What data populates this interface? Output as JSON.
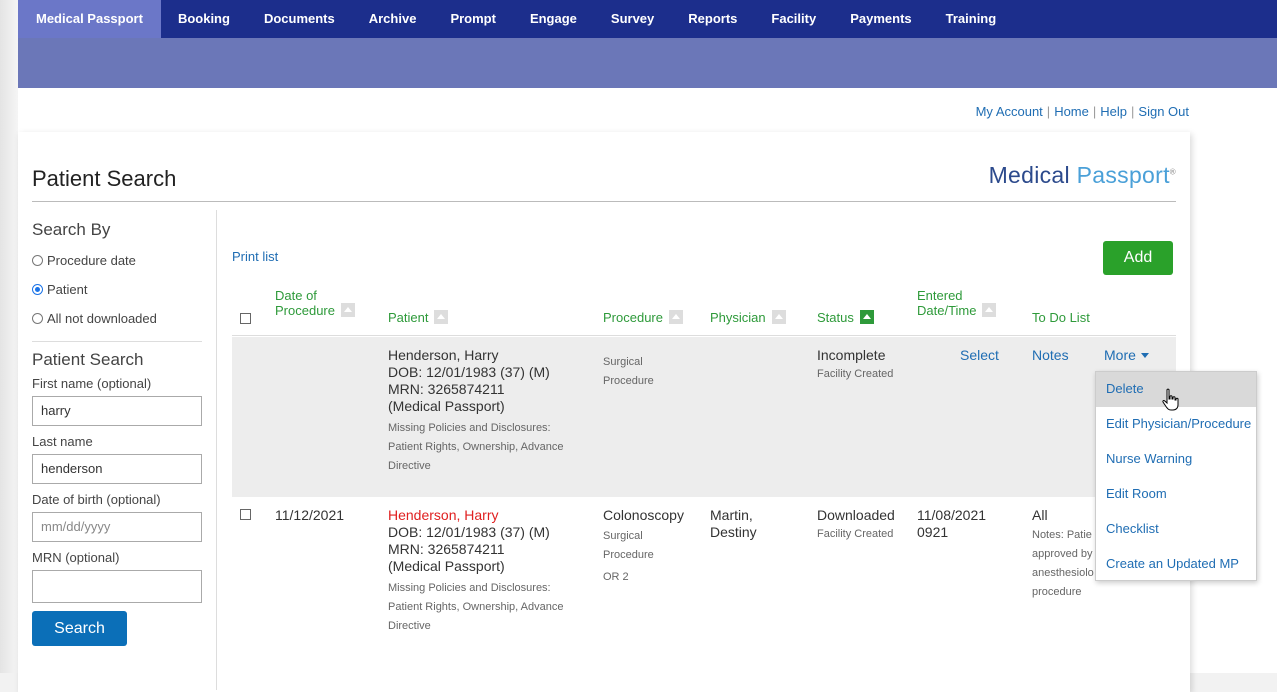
{
  "nav": {
    "tabs": [
      {
        "label": "Medical Passport"
      },
      {
        "label": "Booking"
      },
      {
        "label": "Documents"
      },
      {
        "label": "Archive"
      },
      {
        "label": "Prompt"
      },
      {
        "label": "Engage"
      },
      {
        "label": "Survey"
      },
      {
        "label": "Reports"
      },
      {
        "label": "Facility"
      },
      {
        "label": "Payments"
      },
      {
        "label": "Training"
      }
    ],
    "active_index": 0,
    "colors": {
      "bar": "#1c2e8c",
      "active": "#6b77c8",
      "subbar": "#6b77b8"
    }
  },
  "utility": {
    "my_account": "My Account",
    "home": "Home",
    "help": "Help",
    "sign_out": "Sign Out",
    "separator": "|"
  },
  "page": {
    "title": "Patient Search",
    "brand_bold": "Medical",
    "brand_light": " Passport",
    "brand_mark": "®"
  },
  "sidebar": {
    "search_by_heading": "Search By",
    "options": [
      {
        "label": "Procedure date",
        "checked": false
      },
      {
        "label": "Patient",
        "checked": true
      },
      {
        "label": "All not downloaded",
        "checked": false
      }
    ],
    "patient_search_heading": "Patient Search",
    "first_name_label": "First name (optional)",
    "first_name_value": "harry",
    "last_name_label": "Last name",
    "last_name_value": "henderson",
    "dob_label": "Date of birth (optional)",
    "dob_placeholder": "mm/dd/yyyy",
    "mrn_label": "MRN (optional)",
    "mrn_value": "",
    "search_button": "Search"
  },
  "main": {
    "print_list": "Print list",
    "add_button": "Add",
    "columns": {
      "date_line1": "Date of",
      "date_line2": "Procedure",
      "patient": "Patient",
      "procedure": "Procedure",
      "physician": "Physician",
      "status": "Status",
      "entered_line1": "Entered",
      "entered_line2": "Date/Time",
      "todo": "To Do List"
    },
    "rows": [
      {
        "date": "",
        "patient_name": "Henderson, Harry",
        "dob": "DOB: 12/01/1983 (37) (M)",
        "mrn": "MRN: 3265874211",
        "mrn_source": "(Medical Passport)",
        "missing_line1": "Missing Policies and Disclosures:",
        "missing_line2": "Patient Rights, Ownership, Advance",
        "missing_line3": "Directive",
        "procedure_main": "",
        "procedure_sub1": "Surgical",
        "procedure_sub2": "Procedure",
        "procedure_room": "",
        "physician": "",
        "status": "Incomplete",
        "status_sub": "Facility Created",
        "entered": "",
        "select": "Select",
        "notes": "Notes",
        "more": "More"
      },
      {
        "date": "11/12/2021",
        "patient_name": "Henderson, Harry",
        "dob": "DOB: 12/01/1983 (37) (M)",
        "mrn": "MRN: 3265874211",
        "mrn_source": "(Medical Passport)",
        "missing_line1": "Missing Policies and Disclosures:",
        "missing_line2": "Patient Rights, Ownership, Advance",
        "missing_line3": "Directive",
        "procedure_main": "Colonoscopy",
        "procedure_sub1": "Surgical",
        "procedure_sub2": "Procedure",
        "procedure_room": "OR 2",
        "physician_line1": "Martin,",
        "physician_line2": "Destiny",
        "status": "Downloaded",
        "status_sub": "Facility Created",
        "entered_line1": "11/08/2021",
        "entered_line2": "0921",
        "todo": "All",
        "todo_notes_1": "Notes: Patie",
        "todo_notes_2": "approved by",
        "todo_notes_3": "anesthesiolo",
        "todo_notes_4": "procedure"
      }
    ]
  },
  "more_menu": {
    "items": [
      {
        "label": "Delete"
      },
      {
        "label": "Edit Physician/Procedure"
      },
      {
        "label": "Nurse Warning"
      },
      {
        "label": "Edit Room"
      },
      {
        "label": "Checklist"
      },
      {
        "label": "Create an Updated MP"
      }
    ],
    "hovered_index": 0
  }
}
